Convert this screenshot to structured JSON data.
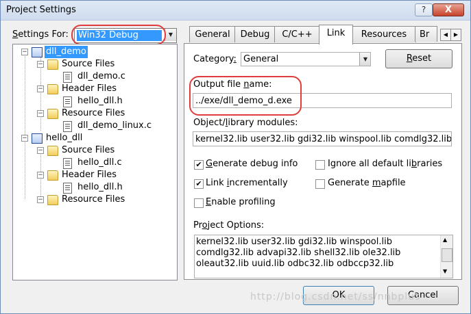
{
  "window": {
    "title": "Project Settings",
    "help_label": "?",
    "close_label": "X"
  },
  "settings_for": {
    "label": "Settings For:",
    "value": "Win32 Debug"
  },
  "tree": [
    {
      "label": "dll_demo",
      "kind": "project",
      "selected": true
    },
    {
      "label": "Source Files",
      "kind": "folder"
    },
    {
      "label": "dll_demo.c",
      "kind": "file"
    },
    {
      "label": "Header Files",
      "kind": "folder"
    },
    {
      "label": "hello_dll.h",
      "kind": "file"
    },
    {
      "label": "Resource Files",
      "kind": "folder"
    },
    {
      "label": "dll_demo_linux.c",
      "kind": "file"
    },
    {
      "label": "hello_dll",
      "kind": "project"
    },
    {
      "label": "Source Files",
      "kind": "folder"
    },
    {
      "label": "hello_dll.c",
      "kind": "file"
    },
    {
      "label": "Header Files",
      "kind": "folder"
    },
    {
      "label": "hello_dll.h",
      "kind": "file"
    },
    {
      "label": "Resource Files",
      "kind": "folder"
    }
  ],
  "tabs": [
    "General",
    "Debug",
    "C/C++",
    "Link",
    "Resources",
    "Br"
  ],
  "active_tab": "Link",
  "link": {
    "category_label": "Category:",
    "category_value": "General",
    "reset_label": "Reset",
    "output_label": "Output file name:",
    "output_value": "../exe/dll_demo_d.exe",
    "modules_label": "Object/library modules:",
    "modules_value": "kernel32.lib user32.lib gdi32.lib winspool.lib comdlg32.lib",
    "checkboxes": [
      {
        "label": "Generate debug info",
        "checked": true
      },
      {
        "label": "Ignore all default libraries",
        "checked": false
      },
      {
        "label": "Link incrementally",
        "checked": true
      },
      {
        "label": "Generate mapfile",
        "checked": false
      },
      {
        "label": "Enable profiling",
        "checked": false
      }
    ],
    "options_label": "Project Options:",
    "options_lines": [
      "kernel32.lib user32.lib gdi32.lib winspool.lib",
      "comdlg32.lib advapi32.lib shell32.lib ole32.lib",
      "oleaut32.lib uuid.lib odbc32.lib odbccp32.lib"
    ]
  },
  "buttons": {
    "ok": "OK",
    "cancel": "Cancel"
  },
  "watermark": "http://blog.csdn.net/ss/nnbplus",
  "colors": {
    "selection": "#3399ff",
    "annotation": "#e03c3c"
  }
}
